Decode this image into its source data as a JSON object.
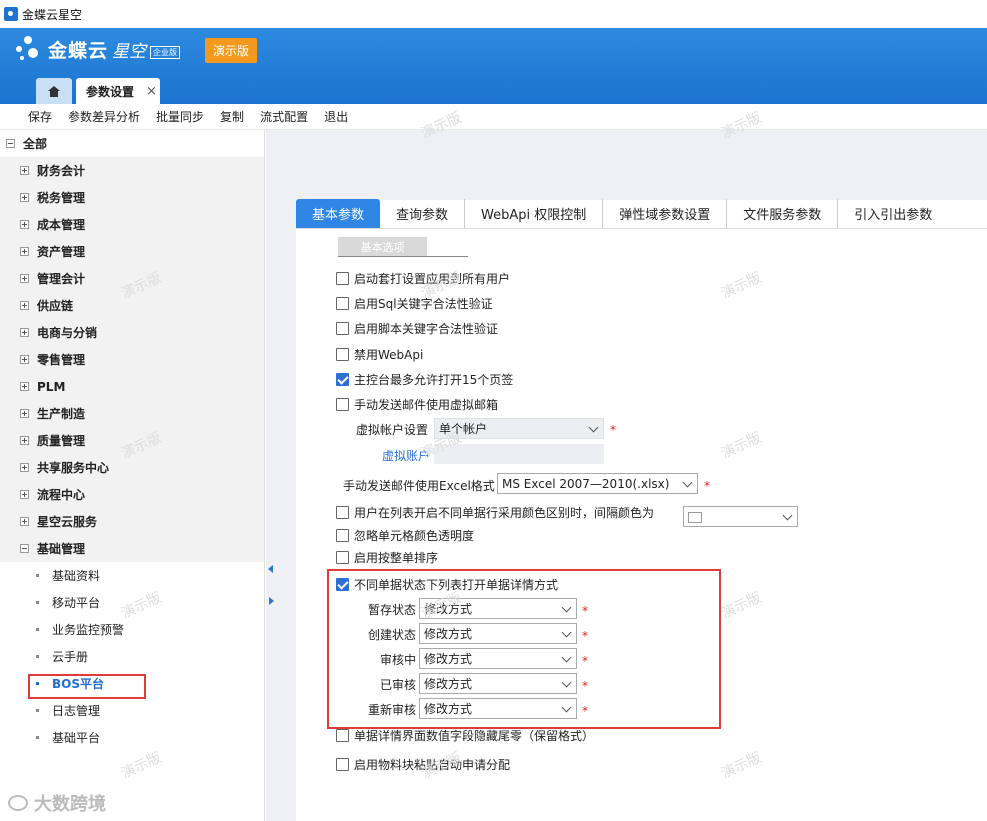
{
  "window": {
    "title": "金蝶云星空"
  },
  "header": {
    "logo_text": "金蝶云",
    "logo_sub": "星空",
    "logo_badge": "企业版",
    "demo_label": "演示版",
    "tab_label": "参数设置",
    "tab_close": "×"
  },
  "toolbar": {
    "items": [
      "保存",
      "参数差异分析",
      "批量同步",
      "复制",
      "流式配置",
      "退出"
    ]
  },
  "sidebar": {
    "root": "全部",
    "groups": [
      "财务会计",
      "税务管理",
      "成本管理",
      "资产管理",
      "管理会计",
      "供应链",
      "电商与分销",
      "零售管理",
      "PLM",
      "生产制造",
      "质量管理",
      "共享服务中心",
      "流程中心",
      "星空云服务",
      "基础管理"
    ],
    "sub_items": [
      "基础资料",
      "移动平台",
      "业务监控预警",
      "云手册",
      "BOS平台",
      "日志管理",
      "基础平台"
    ]
  },
  "tabs": [
    "基本参数",
    "查询参数",
    "WebApi 权限控制",
    "弹性域参数设置",
    "文件服务参数",
    "引入引出参数"
  ],
  "section": {
    "label": "基本选项"
  },
  "options": {
    "o1": "启动套打设置应用到所有用户",
    "o2": "启用Sql关键字合法性验证",
    "o3": "启用脚本关键字合法性验证",
    "o4": "禁用WebApi",
    "o5": "主控台最多允许打开15个页签",
    "o6": "手动发送邮件使用虚拟邮箱",
    "o7": "用户在列表开启不同单据行采用颜色区别时，间隔颜色为",
    "o8": "忽略单元格颜色透明度",
    "o9": "启用按整单排序",
    "o10": "不同单据状态下列表打开单据详情方式",
    "o11": "单据详情界面数值字段隐藏尾零（保留格式）",
    "o12": "启用物料块粘贴自动申请分配"
  },
  "fields": {
    "virtual_account_label": "虚拟帐户设置",
    "virtual_account_value": "单个帐户",
    "virtual_account_link": "虚拟账户",
    "excel_label": "手动发送邮件使用Excel格式",
    "excel_value": "MS Excel 2007—2010(.xlsx)",
    "status_rows": [
      {
        "label": "暂存状态",
        "value": "修改方式"
      },
      {
        "label": "创建状态",
        "value": "修改方式"
      },
      {
        "label": "审核中",
        "value": "修改方式"
      },
      {
        "label": "已审核",
        "value": "修改方式"
      },
      {
        "label": "重新审核",
        "value": "修改方式"
      }
    ],
    "required_mark": "*"
  },
  "watermark": "演示版",
  "bottom_logo": "大数跨境"
}
